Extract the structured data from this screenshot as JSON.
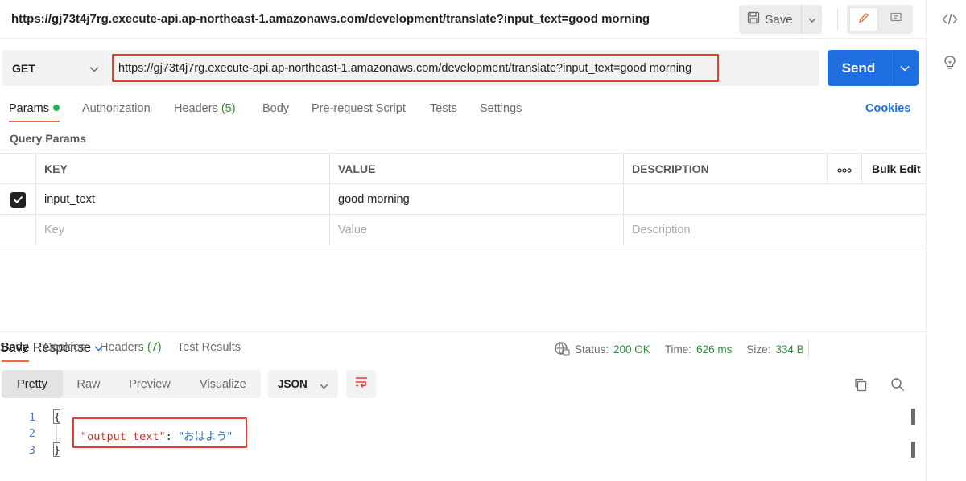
{
  "header": {
    "title": "https://gj73t4j7rg.execute-api.ap-northeast-1.amazonaws.com/development/translate?input_text=good morning",
    "save_label": "Save",
    "icons": {
      "save": "save-disk-icon",
      "edit": "pencil-icon",
      "comment": "comment-icon"
    }
  },
  "right_rail": {
    "icons": [
      "code-icon",
      "lightbulb-icon"
    ]
  },
  "request": {
    "method": "GET",
    "url": "https://gj73t4j7rg.execute-api.ap-northeast-1.amazonaws.com/development/translate?input_text=good morning",
    "send_label": "Send"
  },
  "request_tabs": {
    "params": "Params",
    "authorization": "Authorization",
    "headers": "Headers",
    "headers_count": "(5)",
    "body": "Body",
    "pre_request_script": "Pre-request Script",
    "tests": "Tests",
    "settings": "Settings",
    "cookies": "Cookies"
  },
  "query_params": {
    "title": "Query Params",
    "columns": {
      "key": "KEY",
      "value": "VALUE",
      "description": "DESCRIPTION",
      "more": "ooo",
      "bulk_edit": "Bulk Edit"
    },
    "rows": [
      {
        "checked": true,
        "key": "input_text",
        "value": "good morning",
        "description": ""
      }
    ],
    "placeholder": {
      "key": "Key",
      "value": "Value",
      "description": "Description"
    }
  },
  "response_tabs": {
    "body": "Body",
    "cookies": "Cookies",
    "headers": "Headers",
    "headers_count": "(7)",
    "test_results": "Test Results"
  },
  "response_status": {
    "status_label": "Status:",
    "status_value": "200 OK",
    "time_label": "Time:",
    "time_value": "626 ms",
    "size_label": "Size:",
    "size_value": "334 B",
    "save_response": "Save Response"
  },
  "response_view": {
    "modes": [
      "Pretty",
      "Raw",
      "Preview",
      "Visualize"
    ],
    "active_mode": "Pretty",
    "format": "JSON"
  },
  "response_body": {
    "line_numbers": [
      "1",
      "2",
      "3"
    ],
    "open_brace": "{",
    "close_brace": "}",
    "key": "\"output_text\"",
    "colon": ": ",
    "value": "\"おはよう\""
  },
  "colors": {
    "accent_orange": "#f26b3a",
    "send_blue": "#1f6fe0",
    "status_green": "#2e8b3a",
    "highlight_red": "#e0402f"
  }
}
